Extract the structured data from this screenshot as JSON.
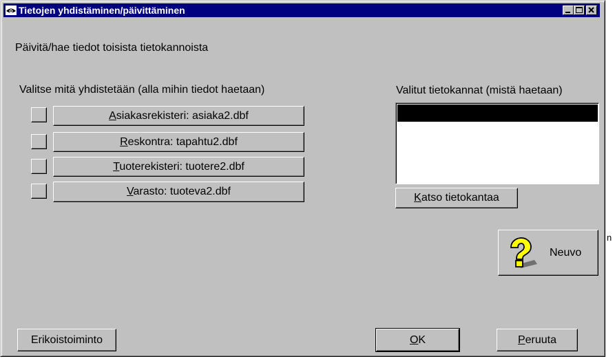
{
  "window": {
    "title": "Tietojen yhdistäminen/päivittäminen",
    "icon": "eye-icon"
  },
  "heading": "Päivitä/hae tiedot toisista tietokannoista",
  "left_section": {
    "label": "Valitse mitä yhdistetään (alla mihin tiedot haetaan)",
    "items": [
      {
        "mnemonic": "A",
        "rest": "siakasrekisteri: asiaka2.dbf"
      },
      {
        "mnemonic": "R",
        "rest": "eskontra: tapahtu2.dbf"
      },
      {
        "mnemonic": "T",
        "rest": "uoterekisteri: tuotere2.dbf"
      },
      {
        "mnemonic": "V",
        "rest": "arasto: tuoteva2.dbf"
      }
    ]
  },
  "right_section": {
    "label": "Valitut tietokannat (mistä haetaan)",
    "view_button": {
      "mnemonic": "K",
      "rest": "atso tietokantaa"
    }
  },
  "help_button": {
    "label": "Neuvo",
    "icon": "help-question-icon"
  },
  "buttons": {
    "special": "Erikoistoiminto",
    "ok": {
      "mnemonic": "O",
      "rest": "K"
    },
    "cancel": {
      "mnemonic": "P",
      "rest": "eruuta"
    }
  },
  "stray_text": "n",
  "colors": {
    "titlebar": "#000080",
    "face": "#c0c0c0"
  }
}
